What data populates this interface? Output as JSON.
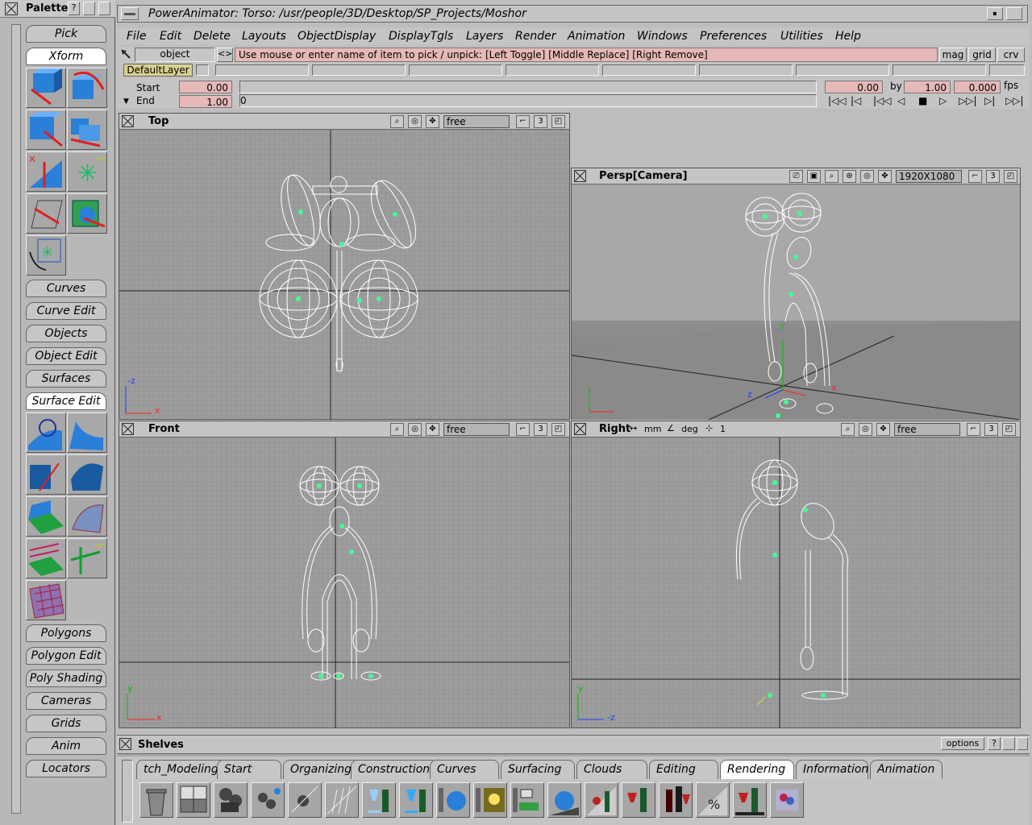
{
  "palette": {
    "title": "Palette",
    "sections": [
      "Pick",
      "Xform",
      "Curves",
      "Curve Edit",
      "Objects",
      "Object Edit",
      "Surfaces",
      "Surface Edit",
      "Polygons",
      "Polygon Edit",
      "Poly Shading",
      "Cameras",
      "Grids",
      "Anim",
      "Locators"
    ],
    "active": [
      "Xform",
      "Surface Edit"
    ]
  },
  "window": {
    "title": "PowerAnimator: Torso: /usr/people/3D/Desktop/SP_Projects/Moshor"
  },
  "menu": [
    "File",
    "Edit",
    "Delete",
    "Layouts",
    "ObjectDisplay",
    "DisplayTgls",
    "Layers",
    "Render",
    "Animation",
    "Windows",
    "Preferences",
    "Utilities",
    "Help"
  ],
  "pick": {
    "mode": "object",
    "arrows": "<>",
    "prompt": "Use mouse or enter name of item to pick / unpick: [Left Toggle] [Middle Replace] [Right Remove]",
    "buttons": [
      "mag",
      "grid",
      "crv"
    ]
  },
  "layer": {
    "default": "DefaultLayer"
  },
  "time": {
    "start_label": "Start",
    "start_value": "0.00",
    "end_label": "End",
    "end_value": "1.00",
    "slider_value": "0",
    "current": "0.00",
    "by_label": "by",
    "by_value": "1.00",
    "fps_value": "0.000",
    "fps_label": "fps",
    "controls": [
      "|◁◁",
      "|◁",
      "|◁◁",
      "◁",
      "■",
      "▷",
      "▷▷|",
      "▷|",
      "▷▷|"
    ]
  },
  "viewports": {
    "top": {
      "title": "Top",
      "mode": "free",
      "num": "3",
      "axis_v": "-z",
      "axis_h": "x"
    },
    "persp": {
      "title": "Persp[Camera]",
      "resolution": "1920X1080",
      "num": "3",
      "axis_v": "y",
      "axis_z": "z",
      "axis_x": "x"
    },
    "front": {
      "title": "Front",
      "mode": "free",
      "num": "3",
      "axis_v": "y",
      "axis_h": "x"
    },
    "right": {
      "title": "Right",
      "mm": "mm",
      "deg": "deg",
      "step": "1",
      "mode": "free",
      "num": "3",
      "axis_v": "y",
      "axis_h": "-z"
    }
  },
  "shelves": {
    "title": "Shelves",
    "options": "options",
    "tabs": [
      "tch_Modeling",
      "Start",
      "Organizing",
      "Construction",
      "Curves",
      "Surfacing",
      "Clouds",
      "Editing",
      "Rendering",
      "Information",
      "Animation"
    ],
    "active_tab": "Rendering"
  },
  "colors": {
    "pink_field": "#e6b8b8",
    "wire": "#ffffff",
    "pivot": "#40ff90",
    "axis_x": "#ff2020",
    "axis_y": "#00c000",
    "axis_z": "#2040ff"
  }
}
